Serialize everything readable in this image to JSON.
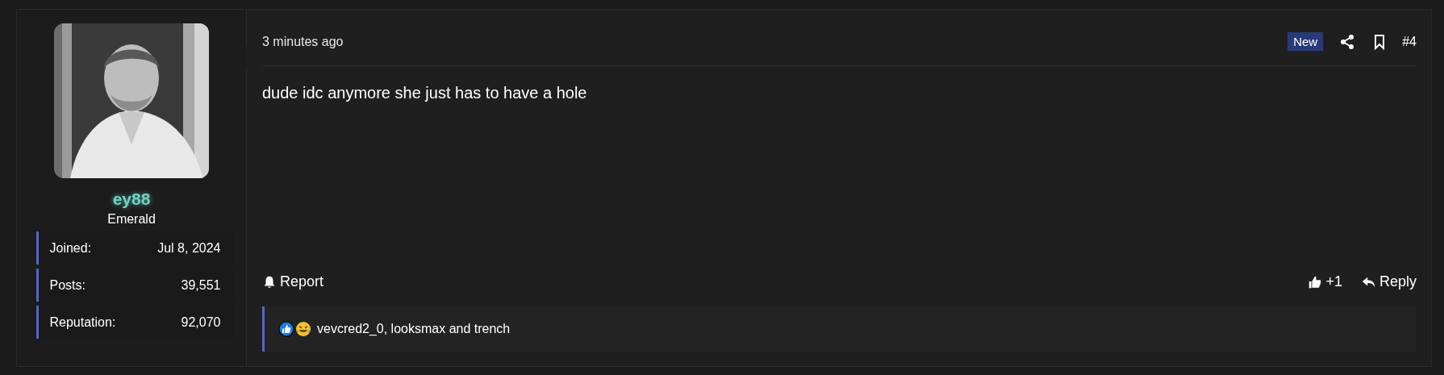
{
  "author": {
    "username": "ey88",
    "rank": "Emerald",
    "stats": [
      {
        "label": "Joined:",
        "value": "Jul 8, 2024"
      },
      {
        "label": "Posts:",
        "value": "39,551"
      },
      {
        "label": "Reputation:",
        "value": "92,070"
      }
    ]
  },
  "post": {
    "time": "3 minutes ago",
    "badge": "New",
    "number": "#4",
    "message": "dude idc anymore she just has to have a hole",
    "actions": {
      "report": "Report",
      "like_count": "+1",
      "reply": "Reply"
    },
    "reactions": {
      "text": "vevcred2_0, looksmax and trench"
    }
  }
}
